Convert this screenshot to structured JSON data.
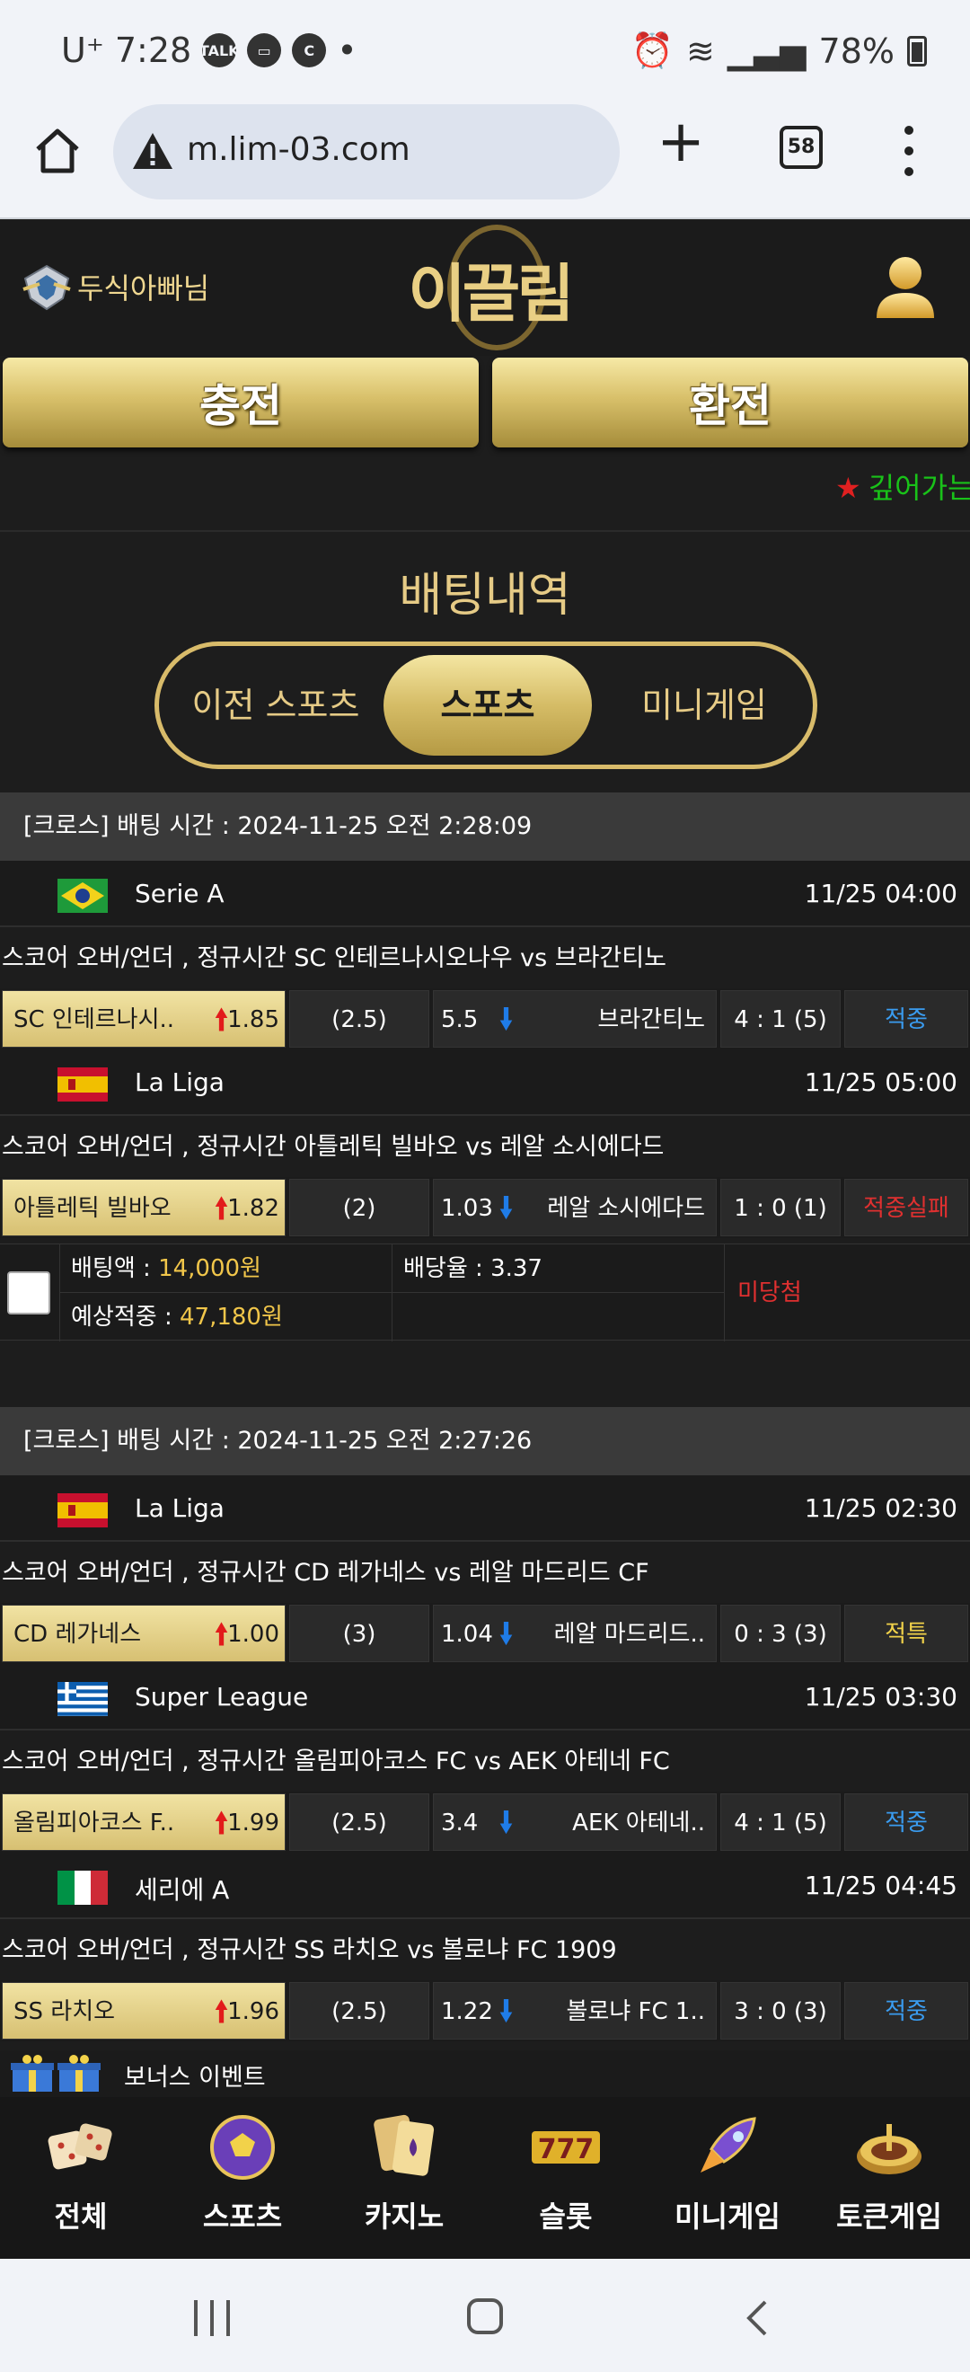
{
  "status_bar": {
    "carrier": "U⁺",
    "time": "7:28",
    "battery": "78%"
  },
  "browser": {
    "url": "m.lim-03.com",
    "tab_count": "58"
  },
  "header": {
    "username": "두식아빠님",
    "logo_text": "이끌림"
  },
  "buttons": {
    "charge": "충전",
    "exchange": "환전"
  },
  "marquee": {
    "text": "깊어가는"
  },
  "page_title": "배팅내역",
  "tabs": {
    "prev_sports": "이전 스포츠",
    "sports": "스포츠",
    "minigame": "미니게임"
  },
  "bets": [
    {
      "header": "[크로스] 배팅 시간 : 2024-11-25 오전 2:28:09",
      "games": [
        {
          "league": "Serie A",
          "time": "11/25 04:00",
          "desc": "스코어 오버/언더 , 정규시간 SC 인테르나시오나우  vs  브라간티노",
          "home": "SC 인테르나시..",
          "home_odd": "1.85",
          "line": "(2.5)",
          "away_odd": "5.5",
          "away": "브라간티노",
          "score": "4 : 1 (5)",
          "result": "적중"
        },
        {
          "league": "La Liga",
          "time": "11/25 05:00",
          "desc": "스코어 오버/언더 , 정규시간 아틀레틱 빌바오  vs  레알 소시에다드",
          "home": "아틀레틱 빌바오",
          "home_odd": "1.82",
          "line": "(2)",
          "away_odd": "1.03",
          "away": "레알 소시에다드",
          "score": "1 : 0 (1)",
          "result": "적중실패"
        }
      ],
      "summary": {
        "bet_amount_label": "배팅액 : ",
        "bet_amount": "14,000원",
        "odds_label": "배당율 : ",
        "odds": "3.37",
        "expected_label": "예상적중 : ",
        "expected": "47,180원",
        "status": "미당첨"
      }
    },
    {
      "header": "[크로스] 배팅 시간 : 2024-11-25 오전 2:27:26",
      "games": [
        {
          "league": "La Liga",
          "time": "11/25 02:30",
          "desc": "스코어 오버/언더 , 정규시간 CD 레가네스  vs  레알 마드리드 CF",
          "home": "CD 레가네스",
          "home_odd": "1.00",
          "line": "(3)",
          "away_odd": "1.04",
          "away": "레알 마드리드..",
          "score": "0 : 3 (3)",
          "result": "적특"
        },
        {
          "league": "Super League",
          "time": "11/25 03:30",
          "desc": "스코어 오버/언더 , 정규시간 올림피아코스 FC  vs  AEK 아테네 FC",
          "home": "올림피아코스 F..",
          "home_odd": "1.99",
          "line": "(2.5)",
          "away_odd": "3.4",
          "away": "AEK 아테네..",
          "score": "4 : 1 (5)",
          "result": "적중"
        },
        {
          "league": "세리에 A",
          "time": "11/25 04:45",
          "desc": "스코어 오버/언더 , 정규시간 SS 라치오  vs  볼로냐 FC 1909",
          "home": "SS 라치오",
          "home_odd": "1.96",
          "line": "(2.5)",
          "away_odd": "1.22",
          "away": "볼로냐 FC 1..",
          "score": "3 : 0 (3)",
          "result": "적중"
        }
      ]
    }
  ],
  "bonus_event": "보너스 이벤트",
  "bottom_nav": [
    "전체",
    "스포츠",
    "카지노",
    "슬롯",
    "미니게임",
    "토큰게임"
  ],
  "colors": {
    "gold": "#e6cb86",
    "win": "#3a9cf0",
    "lose": "#e03030",
    "special": "#f1d24a"
  }
}
